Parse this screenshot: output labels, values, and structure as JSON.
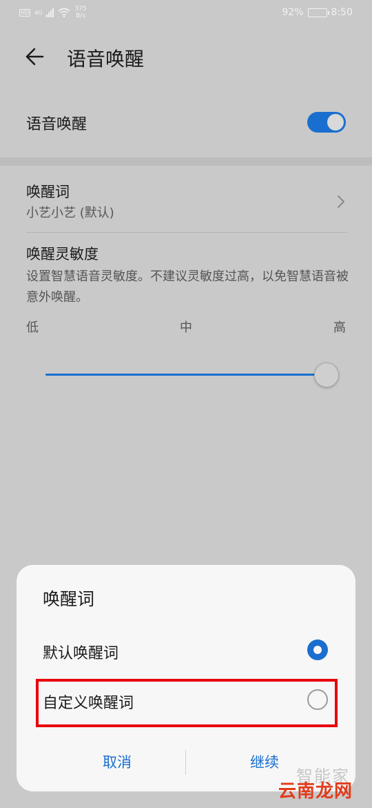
{
  "status_bar": {
    "hd": "HD",
    "network": "4G",
    "speed_value": "375",
    "speed_unit": "B/s",
    "battery": "92%",
    "time": "8:50",
    "battery_level": 0.92
  },
  "header": {
    "back_icon": "arrow-left-icon",
    "title": "语音唤醒"
  },
  "voice_wake": {
    "label": "语音唤醒",
    "enabled": true
  },
  "wake_word": {
    "title": "唤醒词",
    "value": "小艺小艺 (默认)",
    "chevron_icon": "chevron-right-icon"
  },
  "sensitivity": {
    "title": "唤醒灵敏度",
    "description": "设置智慧语音灵敏度。不建议灵敏度过高，以免智慧语音被意外唤醒。",
    "low": "低",
    "mid": "中",
    "high": "高",
    "level": 1.0
  },
  "dialog": {
    "title": "唤醒词",
    "options": [
      {
        "label": "默认唤醒词",
        "selected": true
      },
      {
        "label": "自定义唤醒词",
        "selected": false
      }
    ],
    "cancel": "取消",
    "continue": "继续"
  },
  "watermark": {
    "top": "智能家",
    "bottom": "云南龙网"
  },
  "colors": {
    "accent": "#1a6ecf",
    "highlight": "#e8000d",
    "background": "#c9c9c9"
  }
}
